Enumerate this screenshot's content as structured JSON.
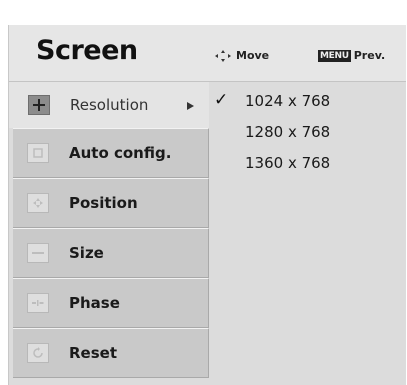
{
  "header": {
    "title": "Screen",
    "move_label": "Move",
    "menu_key": "MENU",
    "prev_label": "Prev."
  },
  "menu": {
    "items": [
      {
        "label": "Resolution",
        "icon": "plus-icon",
        "selected": true
      },
      {
        "label": "Auto config.",
        "icon": "auto-config-icon"
      },
      {
        "label": "Position",
        "icon": "position-icon"
      },
      {
        "label": "Size",
        "icon": "size-icon"
      },
      {
        "label": "Phase",
        "icon": "phase-icon"
      },
      {
        "label": "Reset",
        "icon": "reset-icon"
      }
    ]
  },
  "resolution_options": {
    "selected_index": 0,
    "items": [
      "1024 x 768",
      "1280 x 768",
      "1360 x 768"
    ]
  }
}
